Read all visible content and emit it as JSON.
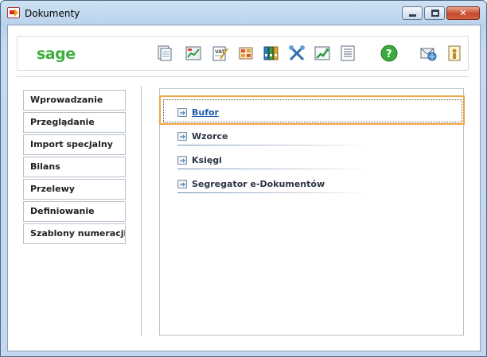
{
  "window": {
    "title": "Dokumenty",
    "min_glyph": "",
    "max_glyph": "",
    "close_glyph": "✕"
  },
  "toolbar": {
    "logo": "sage",
    "icons": [
      "documents-icon",
      "chart-icon",
      "vat-icon",
      "register-icon",
      "binders-icon",
      "tools-icon",
      "growth-chart-icon",
      "list-icon",
      "help-icon",
      "mail-globe-icon",
      "info-icon"
    ]
  },
  "nav": {
    "items": [
      {
        "label": "Wprowadzanie"
      },
      {
        "label": "Przeglądanie"
      },
      {
        "label": "Import specjalny"
      },
      {
        "label": "Bilans"
      },
      {
        "label": "Przelewy"
      },
      {
        "label": "Definiowanie"
      },
      {
        "label": "Szablony numeracji"
      }
    ]
  },
  "panel": {
    "items": [
      {
        "label": "Bufor",
        "selected": true
      },
      {
        "label": "Wzorce"
      },
      {
        "label": "Księgi"
      },
      {
        "label": "Segregator e-Dokumentów"
      }
    ]
  },
  "colors": {
    "focus": "#f0a445",
    "logo": "#3fae3f",
    "link": "#1e5aa8"
  }
}
